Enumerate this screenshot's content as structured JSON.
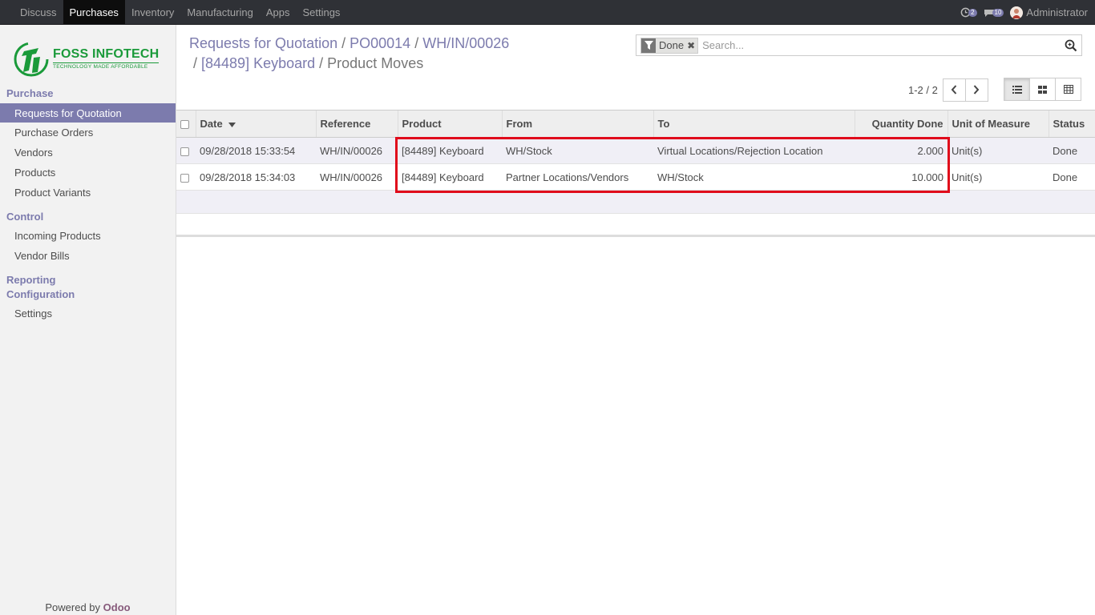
{
  "topnav": {
    "items": [
      {
        "label": "Discuss"
      },
      {
        "label": "Purchases"
      },
      {
        "label": "Inventory"
      },
      {
        "label": "Manufacturing"
      },
      {
        "label": "Apps"
      },
      {
        "label": "Settings"
      }
    ],
    "activity_count": "2",
    "messages_count": "10",
    "user_name": "Administrator"
  },
  "sidebar": {
    "logo_brand": "FOSS INFOTECH",
    "logo_tagline": "TECHNOLOGY MADE AFFORDABLE",
    "section_purchase": "Purchase",
    "purchase_items": [
      {
        "label": "Requests for Quotation"
      },
      {
        "label": "Purchase Orders"
      },
      {
        "label": "Vendors"
      },
      {
        "label": "Products"
      },
      {
        "label": "Product Variants"
      }
    ],
    "section_control": "Control",
    "control_items": [
      {
        "label": "Incoming Products"
      },
      {
        "label": "Vendor Bills"
      }
    ],
    "section_reporting": "Reporting",
    "section_configuration": "Configuration",
    "configuration_items": [
      {
        "label": "Settings"
      }
    ],
    "powered_prefix": "Powered by",
    "powered_brand": "Odoo"
  },
  "breadcrumb": {
    "items": [
      {
        "label": "Requests for Quotation"
      },
      {
        "label": "PO00014"
      },
      {
        "label": "WH/IN/00026"
      },
      {
        "label": "[84489] Keyboard"
      }
    ],
    "current": "Product Moves",
    "separator": "/"
  },
  "search": {
    "facet_value": "Done",
    "placeholder": "Search..."
  },
  "pager": {
    "value": "1-2 / 2"
  },
  "table": {
    "columns": {
      "date": "Date",
      "reference": "Reference",
      "product": "Product",
      "from": "From",
      "to": "To",
      "quantity_done": "Quantity Done",
      "uom": "Unit of Measure",
      "status": "Status"
    },
    "rows": [
      {
        "date": "09/28/2018 15:33:54",
        "reference": "WH/IN/00026",
        "product": "[84489] Keyboard",
        "from": "WH/Stock",
        "to": "Virtual Locations/Rejection Location",
        "quantity_done": "2.000",
        "uom": "Unit(s)",
        "status": "Done"
      },
      {
        "date": "09/28/2018 15:34:03",
        "reference": "WH/IN/00026",
        "product": "[84489] Keyboard",
        "from": "Partner Locations/Vendors",
        "to": "WH/Stock",
        "quantity_done": "10.000",
        "uom": "Unit(s)",
        "status": "Done"
      }
    ]
  },
  "colors": {
    "accent": "#7c7bad",
    "topbar": "#2f3136",
    "highlight": "#e00b1b",
    "logo_green": "#1a9a3a"
  }
}
